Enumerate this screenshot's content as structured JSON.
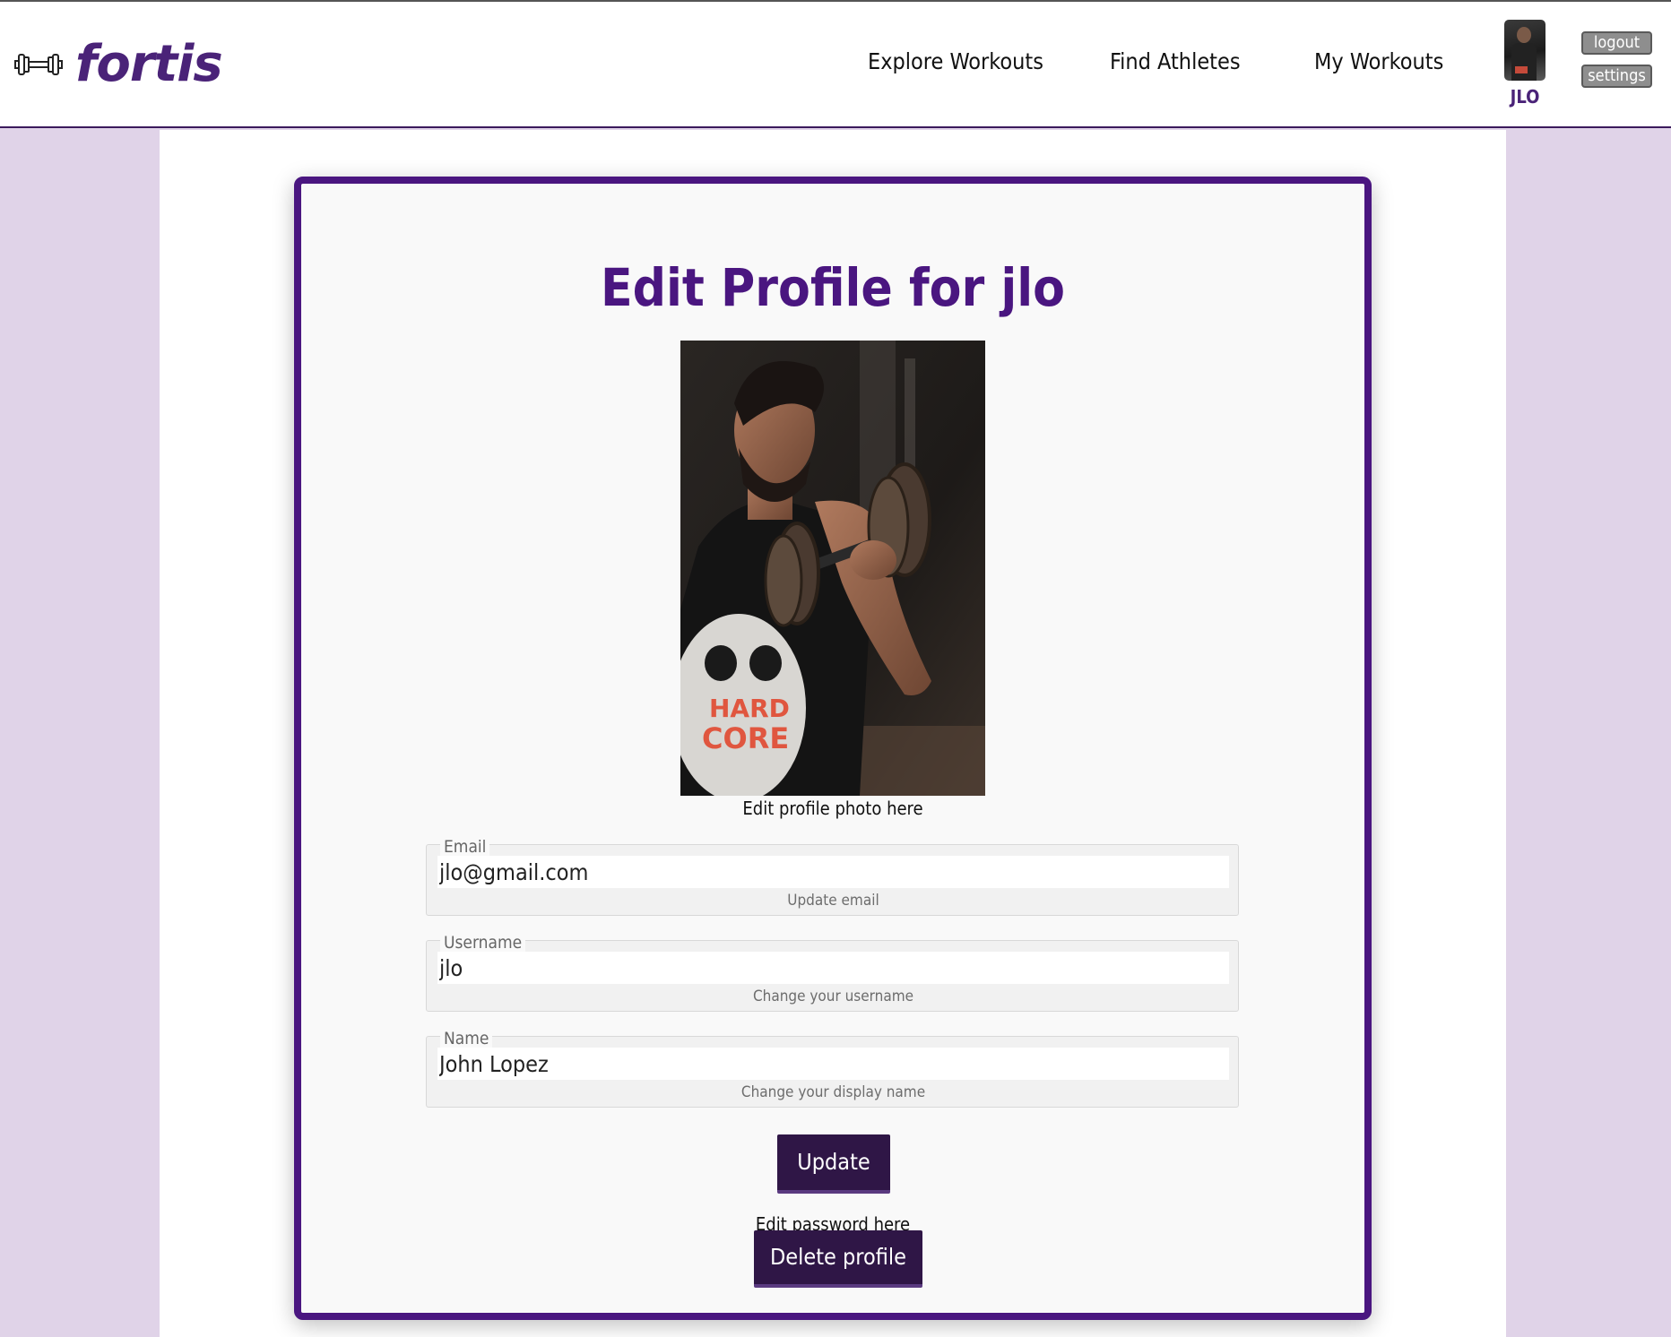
{
  "brand": {
    "name": "fortis",
    "icon": "dumbbell-icon"
  },
  "nav": {
    "items": [
      {
        "label": "Explore Workouts"
      },
      {
        "label": "Find Athletes"
      },
      {
        "label": "My Workouts"
      }
    ]
  },
  "user": {
    "label": "JLO"
  },
  "header_buttons": {
    "logout": "logout",
    "settings": "settings"
  },
  "colors": {
    "accent": "#4a1680",
    "brand": "#4a2378",
    "button": "#2f1646",
    "page_bg": "#e0d3e8"
  },
  "card": {
    "title": "Edit Profile for jlo",
    "photo_caption": "Edit profile photo here",
    "fields": {
      "email": {
        "legend": "Email",
        "value": "jlo@gmail.com",
        "help": "Update email"
      },
      "username": {
        "legend": "Username",
        "value": "jlo",
        "help": "Change your username"
      },
      "name": {
        "legend": "Name",
        "value": "John Lopez",
        "help": "Change your display name"
      }
    },
    "update_label": "Update",
    "password_link": "Edit password here",
    "delete_label": "Delete profile"
  }
}
